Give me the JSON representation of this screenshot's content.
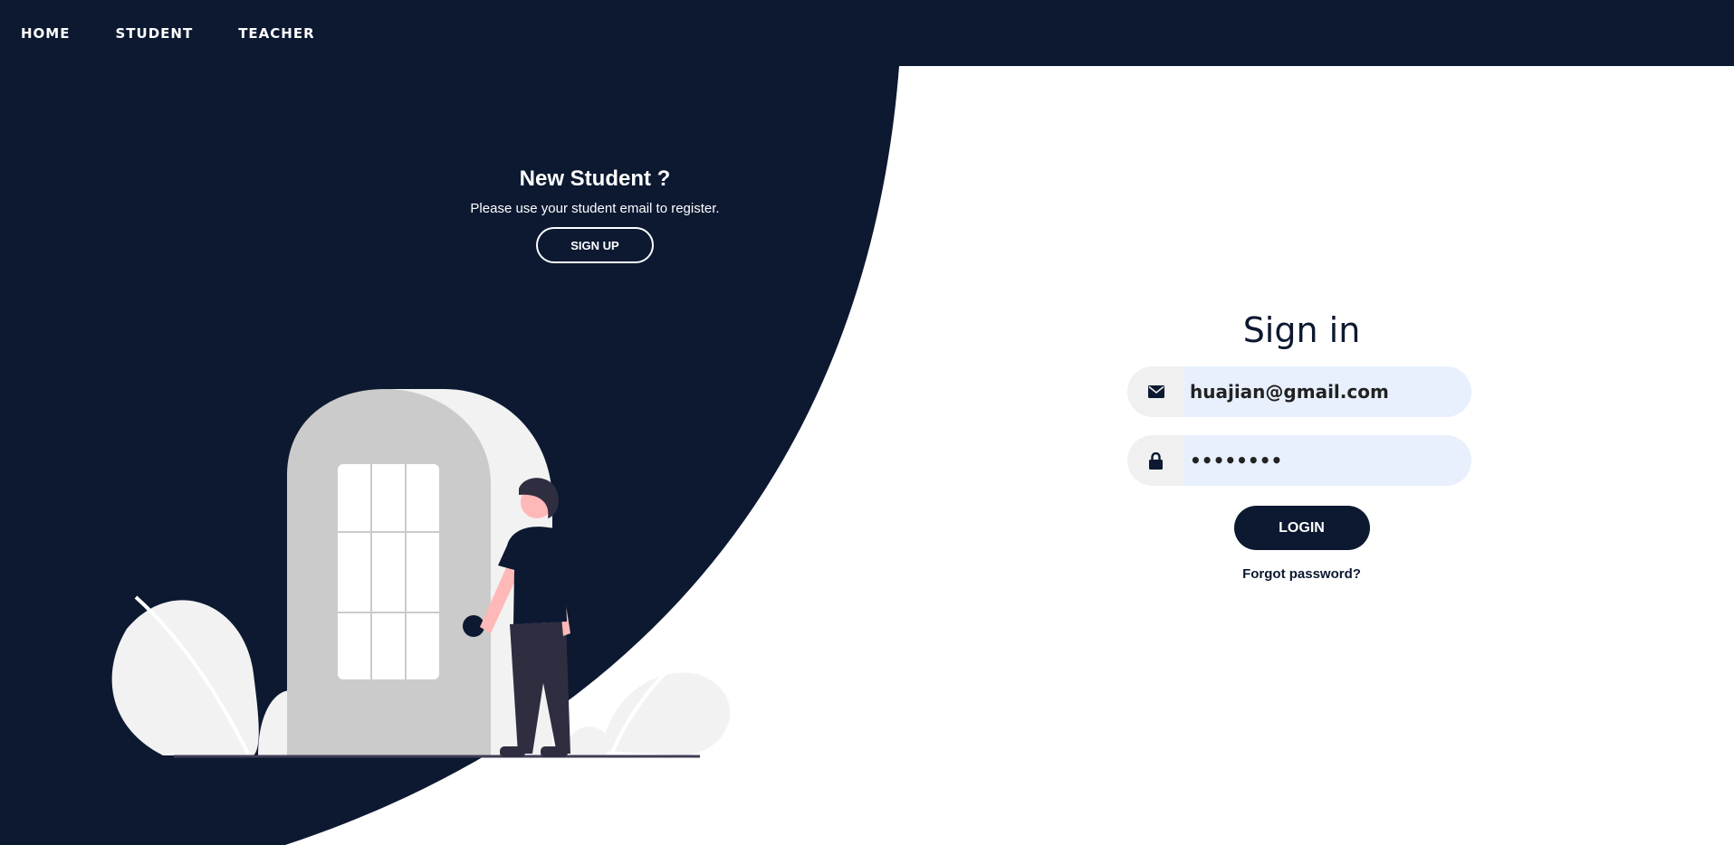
{
  "nav": {
    "items": [
      {
        "label": "HOME"
      },
      {
        "label": "STUDENT"
      },
      {
        "label": "TEACHER"
      }
    ]
  },
  "left_panel": {
    "title": "New Student ?",
    "subtitle": "Please use your student email to register.",
    "signup_label": "SIGN UP"
  },
  "signin": {
    "title": "Sign in",
    "email": {
      "value": "huajian@gmail.com",
      "icon": "envelope-icon"
    },
    "password": {
      "value": "••••••••",
      "icon": "lock-icon"
    },
    "login_label": "LOGIN",
    "forgot_label": "Forgot password?"
  },
  "colors": {
    "navy": "#0c1931",
    "white": "#ffffff",
    "autofill": "#e8f0fe"
  }
}
